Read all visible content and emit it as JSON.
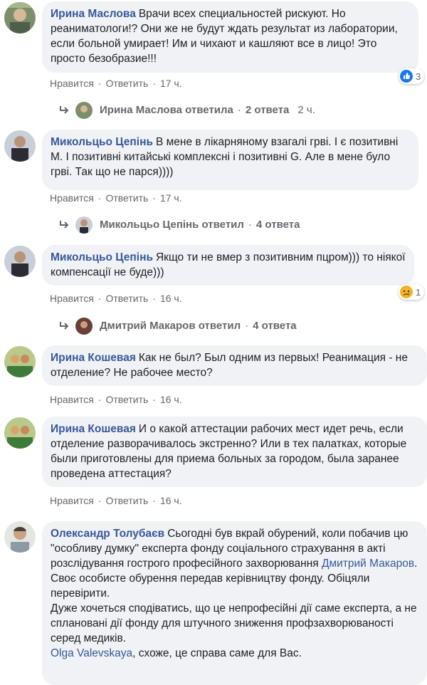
{
  "labels": {
    "like": "Нравится",
    "reply": "Ответить"
  },
  "comments": [
    {
      "author": "Ирина Маслова",
      "text": "Врачи всех специальностей рискуют. Но реаниматологи!? Они же не будут ждать результат из лаборатории, если больной умирает! Им и чихают и кашляют все в лицо! Это просто безобразие!!!",
      "time": "17 ч.",
      "reaction": {
        "type": "like",
        "count": "3"
      },
      "replies": {
        "author": "Ирина Маслова",
        "verb": "ответила",
        "count": "2 ответа",
        "time": "2 ч."
      }
    },
    {
      "author": "Микольцьо Цепінь",
      "text": "В мене в лікарняному взагалі грві. І є позитивні М. І позитивні китайські комплексні і позитивні G. Але в мене було грві. Так що не парся))))",
      "time": "17 ч.",
      "replies": {
        "author": "Микольцьо Цепінь",
        "verb": "ответил",
        "count": "4 ответа"
      }
    },
    {
      "author": "Микольцьо Цепінь",
      "text": "Якщо ти не вмер з позитивним пцром))) то ніякої компенсації не буде)))",
      "time": "16 ч.",
      "reaction": {
        "type": "sad",
        "count": "1"
      },
      "replies": {
        "author": "Дмитрий Макаров",
        "verb": "ответил",
        "count": "4 ответа"
      }
    },
    {
      "author": "Ирина Кошевая",
      "text": "Как не был? Был одним из первых! Реанимация - не отделение? Не рабочее место?",
      "time": "16 ч."
    },
    {
      "author": "Ирина Кошевая",
      "text": "И о какой аттестации рабочих мест идет речь, если отделение разворачивалось экстренно? Или в тех палатках, которые были приготовлены для приема больных за городом, была заранее проведена аттестация?",
      "time": "16 ч."
    },
    {
      "author": "Олександр Толубаєв",
      "text_part1": "Сьогодні був вкрай обурений, коли побачив цю \"особливу думку\" експерта фонду соціального страхування в акті розслідування гострого професійного захворювання",
      "mention1": "Дмитрий Макаров",
      "text_part2": "Своє особисте обурення передав керівництву фонду. Обіцяли перевірити.",
      "text_part3": "Дуже хочеться сподіватись, що це непрофесійні дії саме експерта, а не сплановані дії фонду для штучного зниження профзахворюваності серед медиків.",
      "mention2": "Olga Valevskaya",
      "text_part4": ", схоже, це справа саме для Вас."
    }
  ],
  "colors": {
    "link": "#385898",
    "bubble": "#f0f2f5",
    "meta": "#65676b",
    "like_blue": "#1877f2",
    "sad_yellow": "#f7b125"
  }
}
